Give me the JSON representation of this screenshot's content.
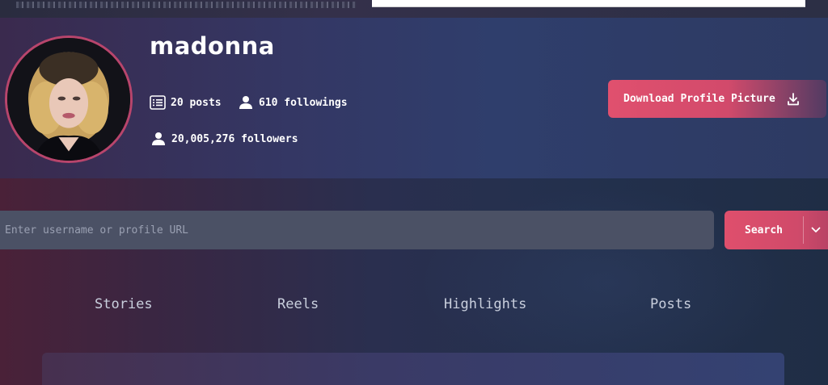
{
  "profile": {
    "username": "madonna",
    "posts": "20 posts",
    "followings": "610 followings",
    "followers": "20,005,276 followers"
  },
  "download_button": {
    "label": "Download Profile Picture",
    "icon": "download-icon"
  },
  "search": {
    "placeholder": "Enter username or profile URL",
    "value": "",
    "button_label": "Search",
    "dropdown_icon": "chevron-down-icon"
  },
  "tabs": [
    {
      "label": "Stories"
    },
    {
      "label": "Reels"
    },
    {
      "label": "Highlights"
    },
    {
      "label": "Posts"
    }
  ],
  "colors": {
    "accent": "#df4f6c",
    "panel": "#343764",
    "input_bg": "#4b5165"
  }
}
